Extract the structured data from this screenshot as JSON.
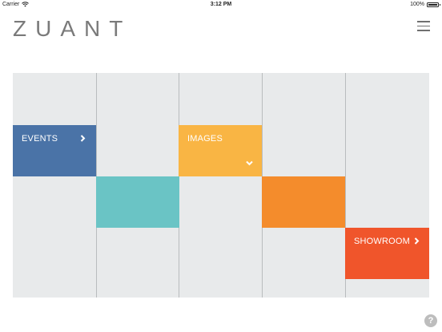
{
  "status_bar": {
    "carrier": "Carrier",
    "time": "3:12 PM",
    "battery_percent": "100%"
  },
  "header": {
    "logo": "ZUANT",
    "menu_icon": "hamburger-menu-icon"
  },
  "tiles": {
    "events": {
      "label": "EVENTS",
      "color": "#4a73a7",
      "icon": "chevron-right-icon"
    },
    "teal": {
      "color": "#6ac4c5"
    },
    "images": {
      "label": "IMAGES",
      "color": "#f9b544",
      "icon": "chevron-down-icon"
    },
    "orange": {
      "color": "#f48c2c"
    },
    "showroom": {
      "label": "SHOWROOM",
      "color": "#f0552b",
      "icon": "chevron-right-icon"
    }
  },
  "grid": {
    "background": "#e8eaeb",
    "columns": 5
  },
  "help": {
    "label": "?",
    "icon": "help-icon"
  }
}
